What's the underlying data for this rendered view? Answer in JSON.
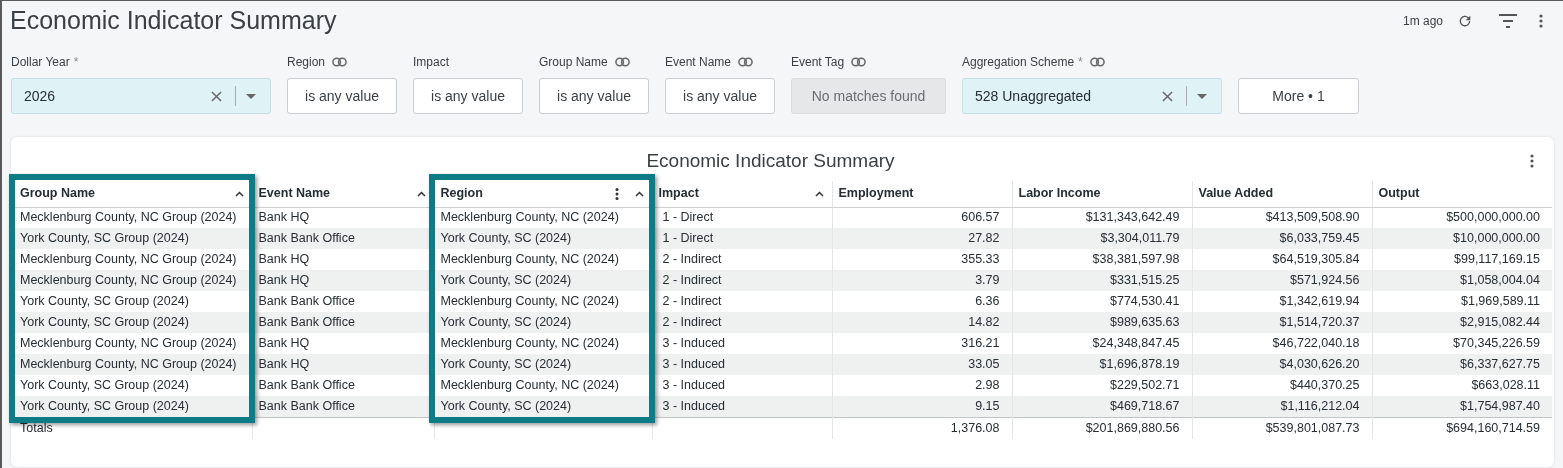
{
  "header": {
    "title": "Economic Indicator Summary",
    "updated": "1m ago"
  },
  "filters": [
    {
      "label": "Dollar Year",
      "required_mark": "*",
      "linked": false,
      "kind": "select",
      "value": "2026"
    },
    {
      "label": "Region",
      "linked": true,
      "kind": "text",
      "value": "is any value"
    },
    {
      "label": "Impact",
      "linked": false,
      "kind": "text",
      "value": "is any value"
    },
    {
      "label": "Group Name",
      "linked": true,
      "kind": "text",
      "value": "is any value"
    },
    {
      "label": "Event Name",
      "linked": true,
      "kind": "text",
      "value": "is any value"
    },
    {
      "label": "Event Tag",
      "linked": true,
      "kind": "disabled",
      "placeholder": "No matches found"
    },
    {
      "label": "Aggregation Scheme",
      "required_mark": "*",
      "linked": true,
      "kind": "select",
      "value": "528 Unaggregated"
    }
  ],
  "more_button": "More • 1",
  "table": {
    "title": "Economic Indicator Summary",
    "columns": [
      {
        "label": "Group Name",
        "kind": "text",
        "sortable": true,
        "menu": false,
        "highlighted": true
      },
      {
        "label": "Event Name",
        "kind": "text",
        "sortable": true,
        "menu": false,
        "highlighted": false
      },
      {
        "label": "Region",
        "kind": "text",
        "sortable": true,
        "menu": true,
        "highlighted": true
      },
      {
        "label": "Impact",
        "kind": "text",
        "sortable": true,
        "menu": false,
        "highlighted": false
      },
      {
        "label": "Employment",
        "kind": "number",
        "sortable": false,
        "menu": false,
        "highlighted": false
      },
      {
        "label": "Labor Income",
        "kind": "number",
        "sortable": false,
        "menu": false,
        "highlighted": false
      },
      {
        "label": "Value Added",
        "kind": "number",
        "sortable": false,
        "menu": false,
        "highlighted": false
      },
      {
        "label": "Output",
        "kind": "number",
        "sortable": false,
        "menu": false,
        "highlighted": false
      }
    ],
    "rows": [
      [
        "Mecklenburg County, NC Group (2024)",
        "Bank HQ",
        "Mecklenburg County, NC (2024)",
        "1 - Direct",
        "606.57",
        "$131,343,642.49",
        "$413,509,508.90",
        "$500,000,000.00"
      ],
      [
        "York County, SC Group (2024)",
        "Bank Bank Office",
        "York County, SC (2024)",
        "1 - Direct",
        "27.82",
        "$3,304,011.79",
        "$6,033,759.45",
        "$10,000,000.00"
      ],
      [
        "Mecklenburg County, NC Group (2024)",
        "Bank HQ",
        "Mecklenburg County, NC (2024)",
        "2 - Indirect",
        "355.33",
        "$38,381,597.98",
        "$64,519,305.84",
        "$99,117,169.15"
      ],
      [
        "Mecklenburg County, NC Group (2024)",
        "Bank HQ",
        "York County, SC (2024)",
        "2 - Indirect",
        "3.79",
        "$331,515.25",
        "$571,924.56",
        "$1,058,004.04"
      ],
      [
        "York County, SC Group (2024)",
        "Bank Bank Office",
        "Mecklenburg County, NC (2024)",
        "2 - Indirect",
        "6.36",
        "$774,530.41",
        "$1,342,619.94",
        "$1,969,589.11"
      ],
      [
        "York County, SC Group (2024)",
        "Bank Bank Office",
        "York County, SC (2024)",
        "2 - Indirect",
        "14.82",
        "$989,635.63",
        "$1,514,720.37",
        "$2,915,082.44"
      ],
      [
        "Mecklenburg County, NC Group (2024)",
        "Bank HQ",
        "Mecklenburg County, NC (2024)",
        "3 - Induced",
        "316.21",
        "$24,348,847.45",
        "$46,722,040.18",
        "$70,345,226.59"
      ],
      [
        "Mecklenburg County, NC Group (2024)",
        "Bank HQ",
        "York County, SC (2024)",
        "3 - Induced",
        "33.05",
        "$1,696,878.19",
        "$4,030,626.20",
        "$6,337,627.75"
      ],
      [
        "York County, SC Group (2024)",
        "Bank Bank Office",
        "Mecklenburg County, NC (2024)",
        "3 - Induced",
        "2.98",
        "$229,502.71",
        "$440,370.25",
        "$663,028.11"
      ],
      [
        "York County, SC Group (2024)",
        "Bank Bank Office",
        "York County, SC (2024)",
        "3 - Induced",
        "9.15",
        "$469,718.67",
        "$1,116,212.04",
        "$1,754,987.40"
      ]
    ],
    "totals": {
      "label": "Totals",
      "values": [
        "1,376.08",
        "$201,869,880.56",
        "$539,801,087.73",
        "$694,160,714.59"
      ]
    }
  }
}
